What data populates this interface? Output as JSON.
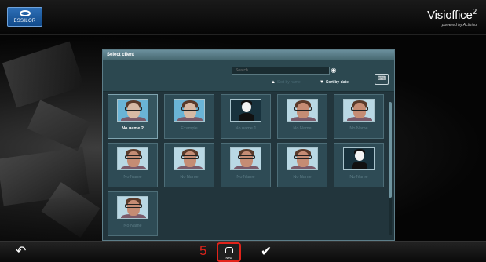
{
  "header": {
    "logo_text": "ESSILOR",
    "brand_main": "Visioffice",
    "brand_sup": "2",
    "brand_sub": "powered by Activisu"
  },
  "dialog": {
    "title": "Select client",
    "search_placeholder": "Search",
    "sort_by_name": "Sort by name",
    "sort_by_date": "Sort by date"
  },
  "clients": [
    {
      "name": "No name 2",
      "thumb": "facescan-photo",
      "active": true
    },
    {
      "name": "Example",
      "thumb": "facescan-photo",
      "active": false
    },
    {
      "name": "No name 1",
      "thumb": "avatar-placeholder",
      "active": false
    },
    {
      "name": "No Name",
      "thumb": "face-photo",
      "active": false
    },
    {
      "name": "No Name",
      "thumb": "face-photo",
      "active": false
    },
    {
      "name": "No Name",
      "thumb": "face-photo",
      "active": false
    },
    {
      "name": "No Name",
      "thumb": "face-photo",
      "active": false
    },
    {
      "name": "No Name",
      "thumb": "face-photo",
      "active": false
    },
    {
      "name": "No Name",
      "thumb": "face-photo",
      "active": false
    },
    {
      "name": "No Name",
      "thumb": "avatar-placeholder",
      "active": false
    },
    {
      "name": "No Name",
      "thumb": "face-photo",
      "active": false
    }
  ],
  "footer": {
    "step_marker": "5",
    "new_label": "New",
    "back_icon": "back-arrow-icon",
    "confirm_icon": "checkmark-icon",
    "new_icon": "new-client-icon"
  },
  "colors": {
    "accent_red": "#e2231a",
    "panel_bg": "#22353c",
    "card_bg": "#2e4b55"
  }
}
